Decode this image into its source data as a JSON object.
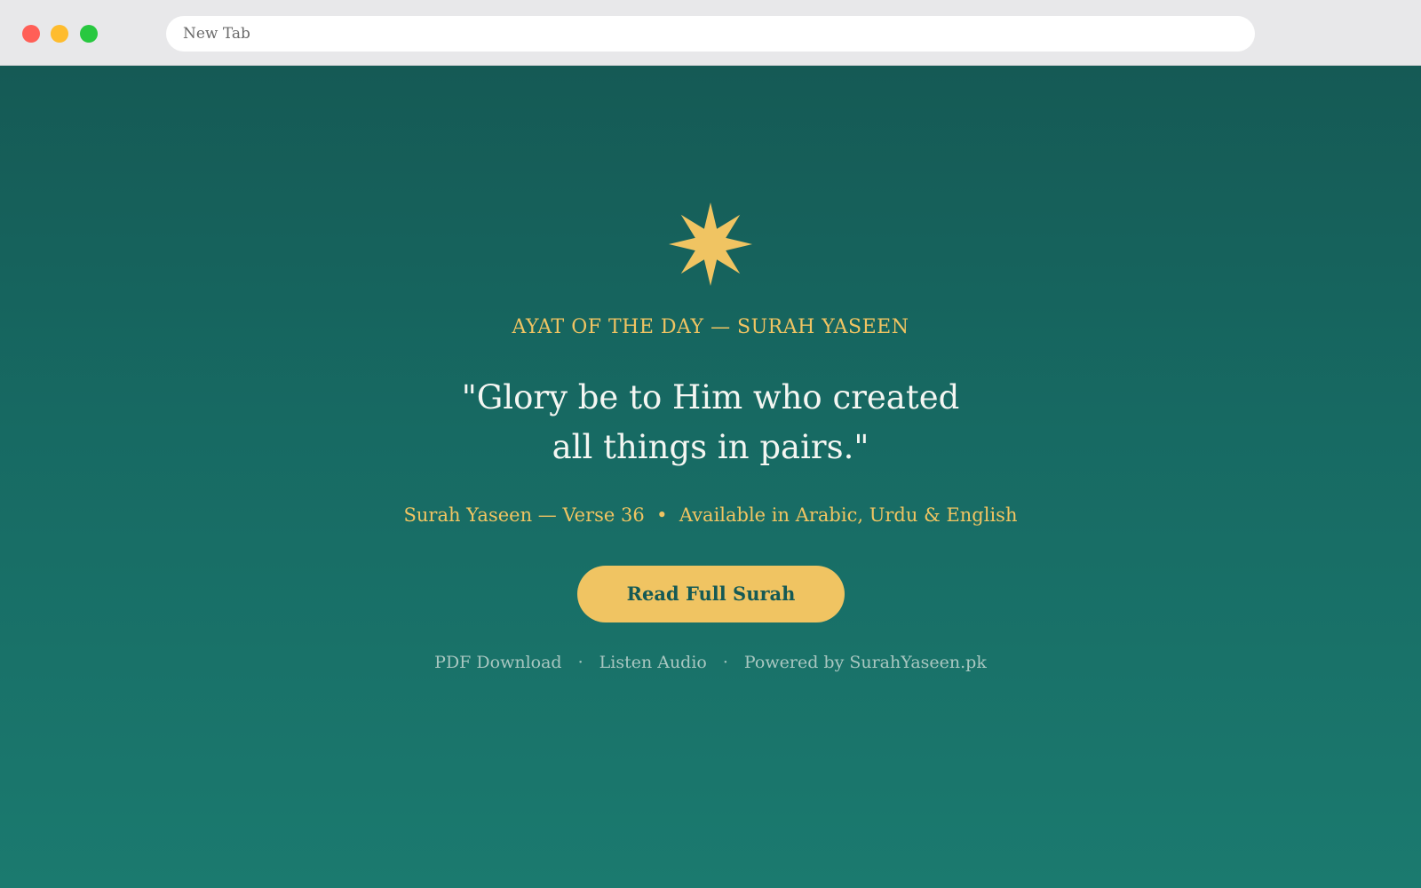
{
  "browser": {
    "address_bar_text": "New Tab"
  },
  "hero": {
    "icon": "eight-point-star-icon",
    "kicker": "AYAT OF THE DAY — SURAH YASEEN",
    "quote_line1": "\"Glory be to Him who created",
    "quote_line2": "all things in pairs.\"",
    "reference": "Surah Yaseen — Verse 36",
    "meta_separator": "•",
    "languages": "Available in Arabic, Urdu & English",
    "cta_label": "Read Full Surah"
  },
  "footer": {
    "pdf_link": "PDF Download",
    "audio_link": "Listen Audio",
    "powered_by": "Powered by SurahYaseen.pk",
    "separator": "·"
  },
  "colors": {
    "background_top": "#155a55",
    "background_bottom": "#1b7a6f",
    "accent_gold": "#f0c462",
    "quote_text": "#f4f6f2",
    "footer_text": "#a9c7c1"
  }
}
